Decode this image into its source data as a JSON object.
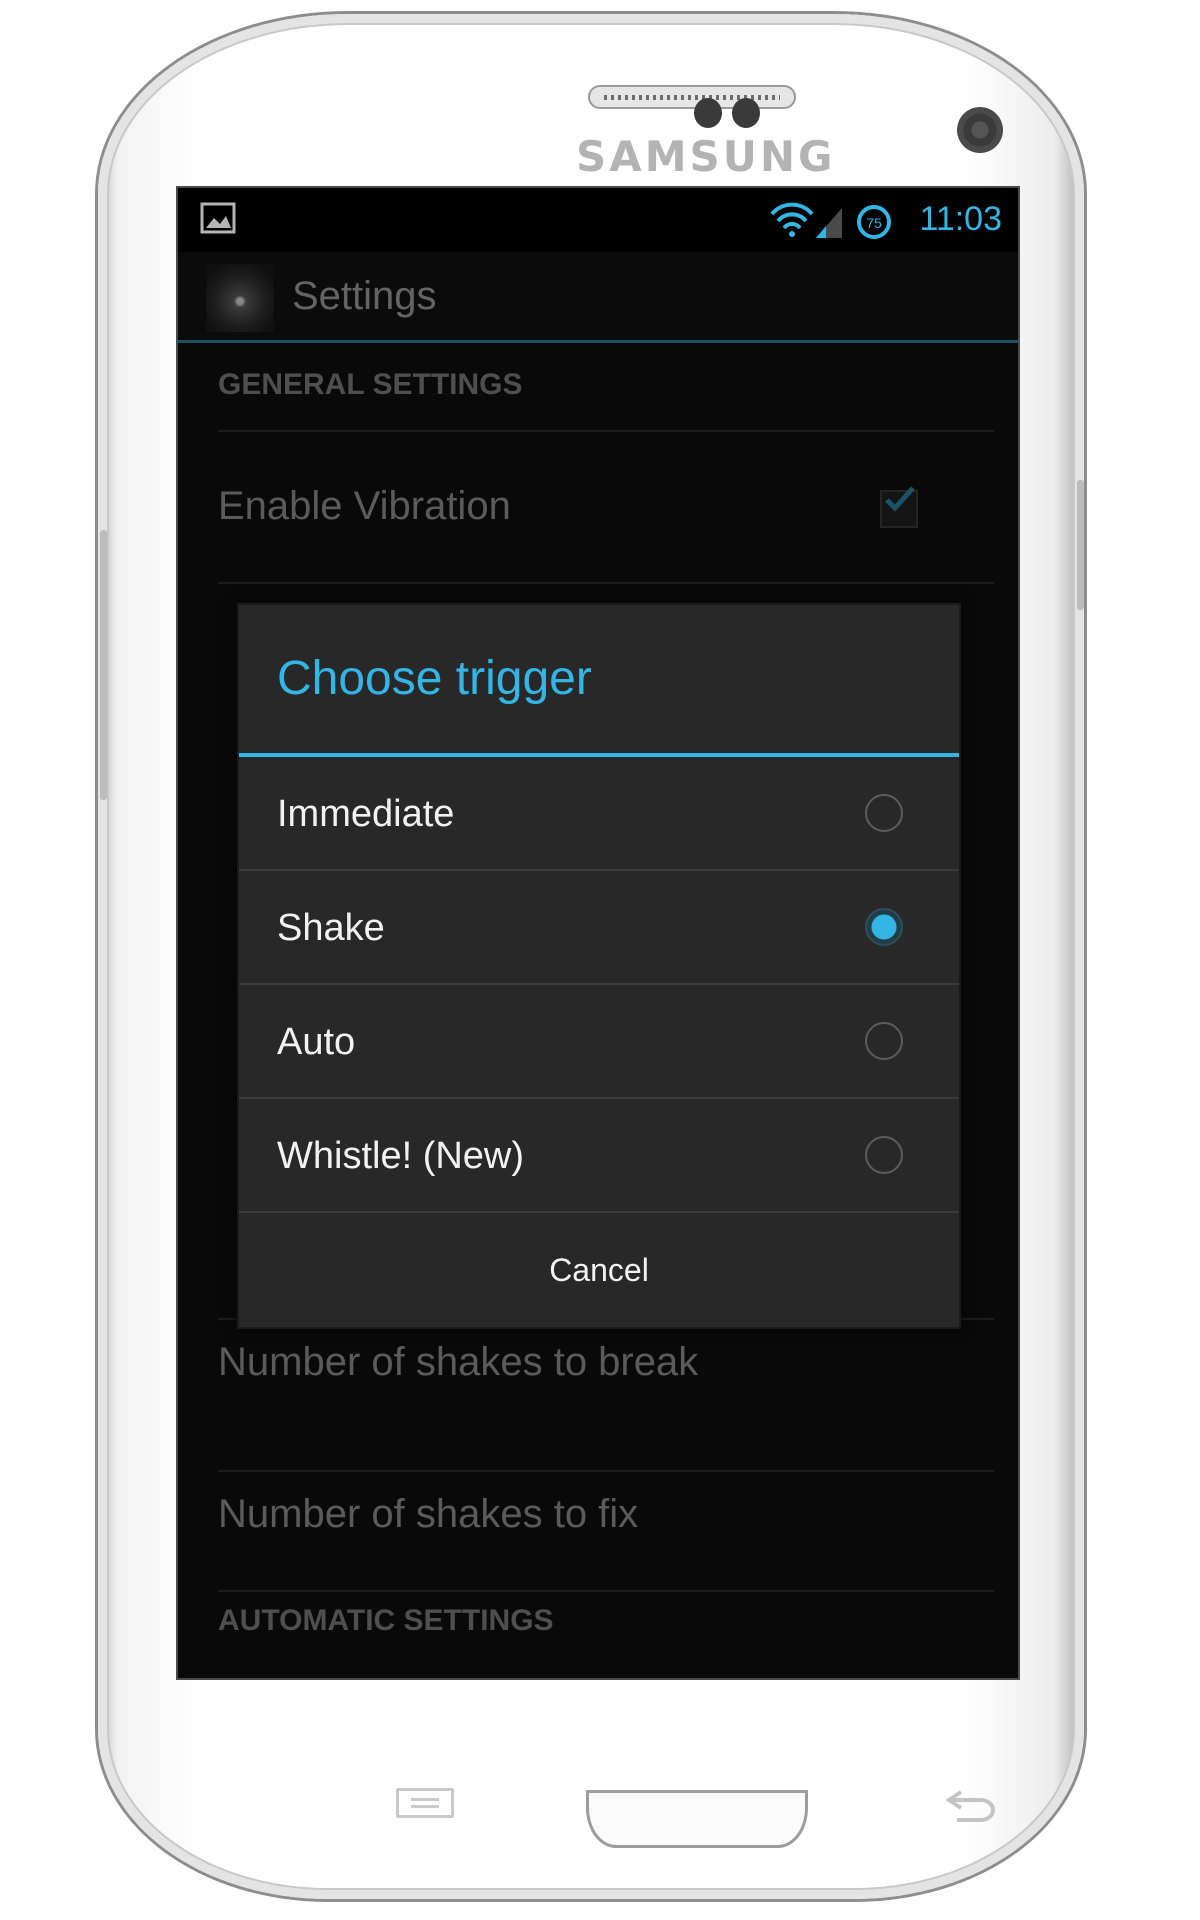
{
  "device": {
    "brand": "SAMSUNG",
    "side_button_colors": "#bcbcbc"
  },
  "status_bar": {
    "time": "11:03",
    "battery_level": "75",
    "accent_color": "#33b5e5",
    "icons": [
      "picture-icon",
      "wifi-icon",
      "signal-icon",
      "data-saver-icon"
    ]
  },
  "action_bar": {
    "title": "Settings",
    "app_icon": "cracked-screen-icon"
  },
  "preferences": {
    "general_header": "GENERAL SETTINGS",
    "enable_vibration": "Enable Vibration",
    "enable_vibration_checked": true,
    "shakes_to_break": "Number of shakes to break",
    "shakes_to_fix": "Number of shakes to fix",
    "automatic_header": "AUTOMATIC SETTINGS"
  },
  "dialog": {
    "title": "Choose trigger",
    "options": [
      {
        "label": "Immediate",
        "selected": false
      },
      {
        "label": "Shake",
        "selected": true
      },
      {
        "label": "Auto",
        "selected": false
      },
      {
        "label": "Whistle! (New)",
        "selected": false
      }
    ],
    "cancel_label": "Cancel"
  }
}
